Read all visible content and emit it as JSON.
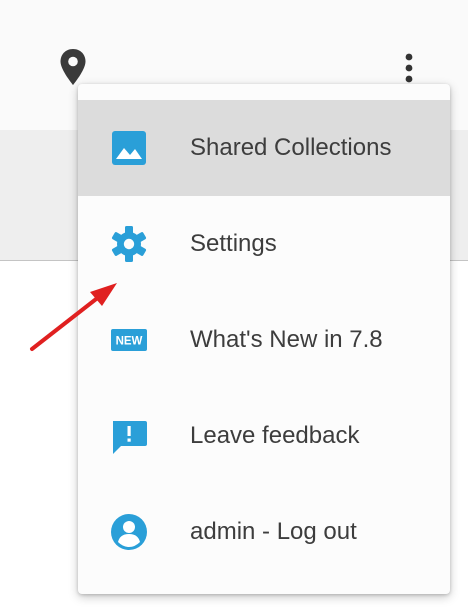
{
  "colors": {
    "accent": "#2a9fd8",
    "annotation_arrow": "#e02020",
    "highlight": "#dcdcdc",
    "text": "#3d3d3d"
  },
  "toolbar": {
    "location_icon": "map-pin-icon",
    "more_icon": "more-vertical-icon"
  },
  "menu": {
    "items": [
      {
        "label": "Shared Collections",
        "icon": "image-icon",
        "highlighted": true
      },
      {
        "label": "Settings",
        "icon": "gear-icon",
        "highlighted": false
      },
      {
        "label": "What's New in 7.8",
        "icon": "new-badge-icon",
        "badge_text": "NEW",
        "highlighted": false
      },
      {
        "label": "Leave feedback",
        "icon": "feedback-icon",
        "highlighted": false
      },
      {
        "label": "admin - Log out",
        "icon": "account-circle-icon",
        "highlighted": false
      }
    ]
  },
  "annotation": {
    "type": "arrow",
    "points_to": "Settings"
  }
}
